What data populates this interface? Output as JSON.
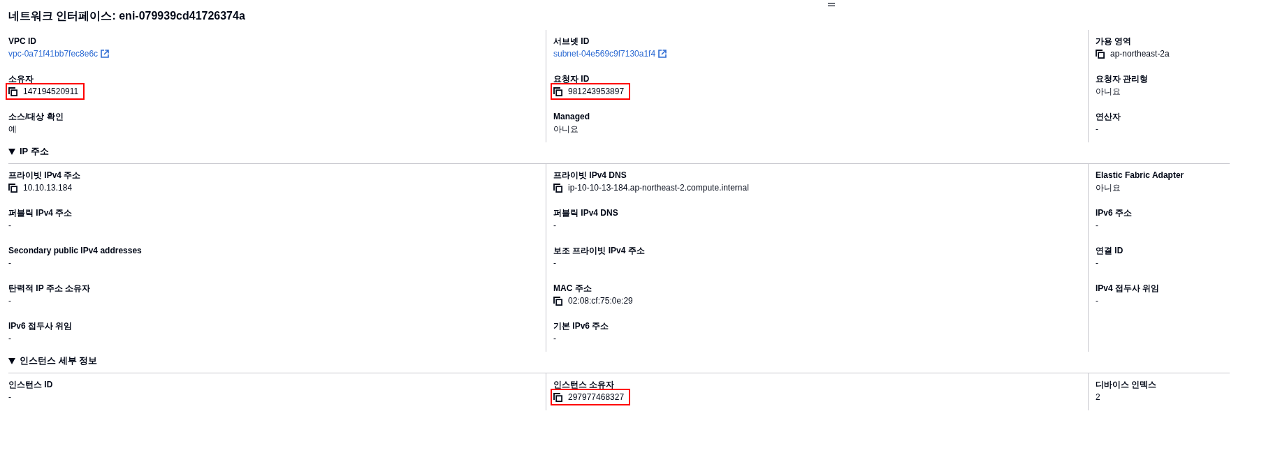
{
  "title": "네트워크 인터페이스: eni-079939cd41726374a",
  "sections": [
    {
      "columns": [
        {
          "fields": [
            {
              "label": "VPC ID",
              "value": "vpc-0a71f41bb7fec8e6c",
              "kind": "link",
              "highlighted": false
            },
            {
              "label": "소유자",
              "value": "147194520911",
              "kind": "copy",
              "highlighted": true
            },
            {
              "label": "소스/대상 확인",
              "value": "예",
              "kind": "text",
              "highlighted": false
            }
          ]
        },
        {
          "fields": [
            {
              "label": "서브넷 ID",
              "value": "subnet-04e569c9f7130a1f4",
              "kind": "link",
              "highlighted": false
            },
            {
              "label": "요청자 ID",
              "value": "981243953897",
              "kind": "copy",
              "highlighted": true
            },
            {
              "label": "Managed",
              "value": "아니요",
              "kind": "text",
              "highlighted": false
            }
          ]
        },
        {
          "fields": [
            {
              "label": "가용 영역",
              "value": "ap-northeast-2a",
              "kind": "copy",
              "highlighted": false
            },
            {
              "label": "요청자 관리형",
              "value": "아니요",
              "kind": "text",
              "highlighted": false
            },
            {
              "label": "연산자",
              "value": "-",
              "kind": "text",
              "highlighted": false
            }
          ]
        }
      ]
    },
    {
      "heading": "IP 주소",
      "expanded": true,
      "columns": [
        {
          "fields": [
            {
              "label": "프라이빗 IPv4 주소",
              "value": "10.10.13.184",
              "kind": "copy",
              "highlighted": false
            },
            {
              "label": "퍼블릭 IPv4 주소",
              "value": "-",
              "kind": "text",
              "highlighted": false
            },
            {
              "label": "Secondary public IPv4 addresses",
              "value": "-",
              "kind": "text",
              "highlighted": false
            },
            {
              "label": "탄력적 IP 주소 소유자",
              "value": "-",
              "kind": "text",
              "highlighted": false
            },
            {
              "label": "IPv6 접두사 위임",
              "value": "-",
              "kind": "text",
              "highlighted": false
            }
          ]
        },
        {
          "fields": [
            {
              "label": "프라이빗 IPv4 DNS",
              "value": "ip-10-10-13-184.ap-northeast-2.compute.internal",
              "kind": "copy",
              "highlighted": false
            },
            {
              "label": "퍼블릭 IPv4 DNS",
              "value": "-",
              "kind": "text",
              "highlighted": false
            },
            {
              "label": "보조 프라이빗 IPv4 주소",
              "value": "-",
              "kind": "text",
              "highlighted": false
            },
            {
              "label": "MAC 주소",
              "value": "02:08:cf:75:0e:29",
              "kind": "copy",
              "highlighted": false
            },
            {
              "label": "기본 IPv6 주소",
              "value": "-",
              "kind": "text",
              "highlighted": false
            }
          ]
        },
        {
          "fields": [
            {
              "label": "Elastic Fabric Adapter",
              "value": "아니요",
              "kind": "text",
              "highlighted": false
            },
            {
              "label": "IPv6 주소",
              "value": "-",
              "kind": "text",
              "highlighted": false
            },
            {
              "label": "연결 ID",
              "value": "-",
              "kind": "text",
              "highlighted": false
            },
            {
              "label": "IPv4 접두사 위임",
              "value": "-",
              "kind": "text",
              "highlighted": false
            }
          ]
        }
      ]
    },
    {
      "heading": "인스턴스 세부 정보",
      "expanded": true,
      "columns": [
        {
          "fields": [
            {
              "label": "인스턴스 ID",
              "value": "-",
              "kind": "text",
              "highlighted": false
            }
          ]
        },
        {
          "fields": [
            {
              "label": "인스턴스 소유자",
              "value": "297977468327",
              "kind": "copy",
              "highlighted": true
            }
          ]
        },
        {
          "fields": [
            {
              "label": "디바이스 인덱스",
              "value": "2",
              "kind": "text",
              "highlighted": false
            }
          ]
        }
      ]
    }
  ]
}
